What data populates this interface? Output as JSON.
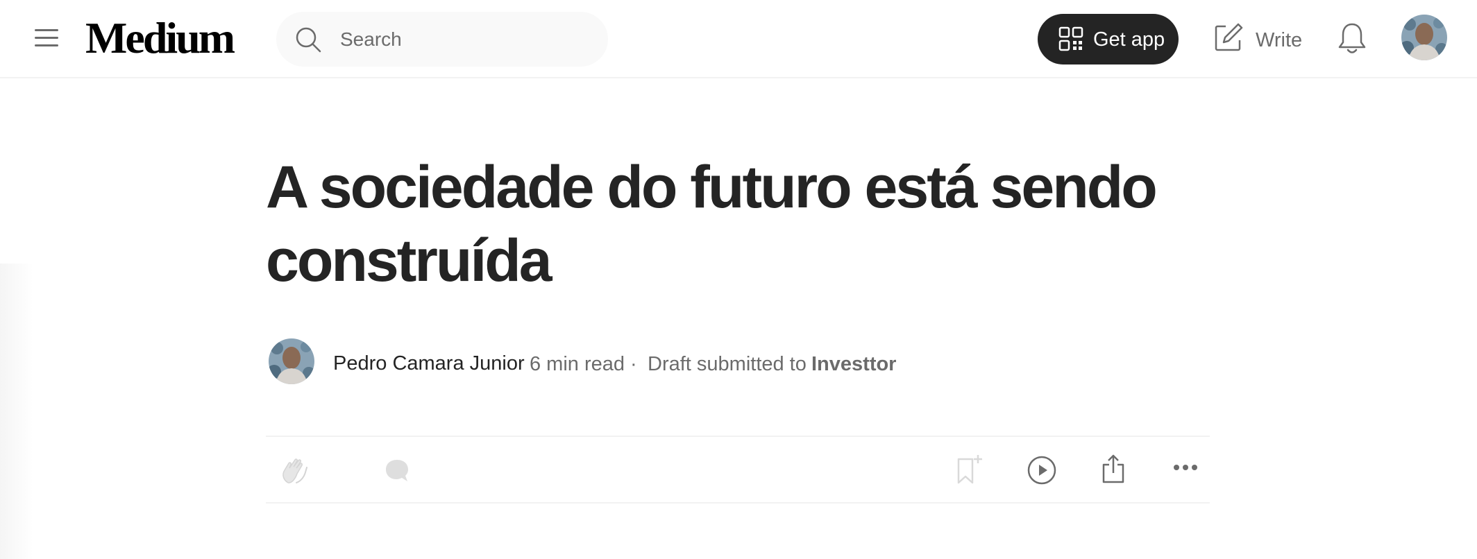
{
  "header": {
    "brand": "Medium",
    "search": {
      "placeholder": "Search",
      "value": ""
    },
    "get_app_label": "Get app",
    "write_label": "Write",
    "icons": [
      "menu-icon",
      "search-icon",
      "qr-code-icon",
      "write-icon",
      "bell-icon",
      "user-avatar"
    ]
  },
  "article": {
    "title": "A sociedade do futuro está sendo construída",
    "author": "Pedro Camara Junior",
    "read_time": "6 min read",
    "separator": "·",
    "status_text": "Draft submitted to",
    "publication": "Investtor"
  },
  "actions": [
    "clap-icon",
    "response-icon",
    "bookmark-icon",
    "listen-icon",
    "share-icon",
    "more-icon"
  ],
  "colors": {
    "text_primary": "#242424",
    "text_secondary": "#6b6b6b",
    "button_dark": "#242424",
    "icon_disabled": "#d9d9d9",
    "divider": "#f2f2f2"
  }
}
